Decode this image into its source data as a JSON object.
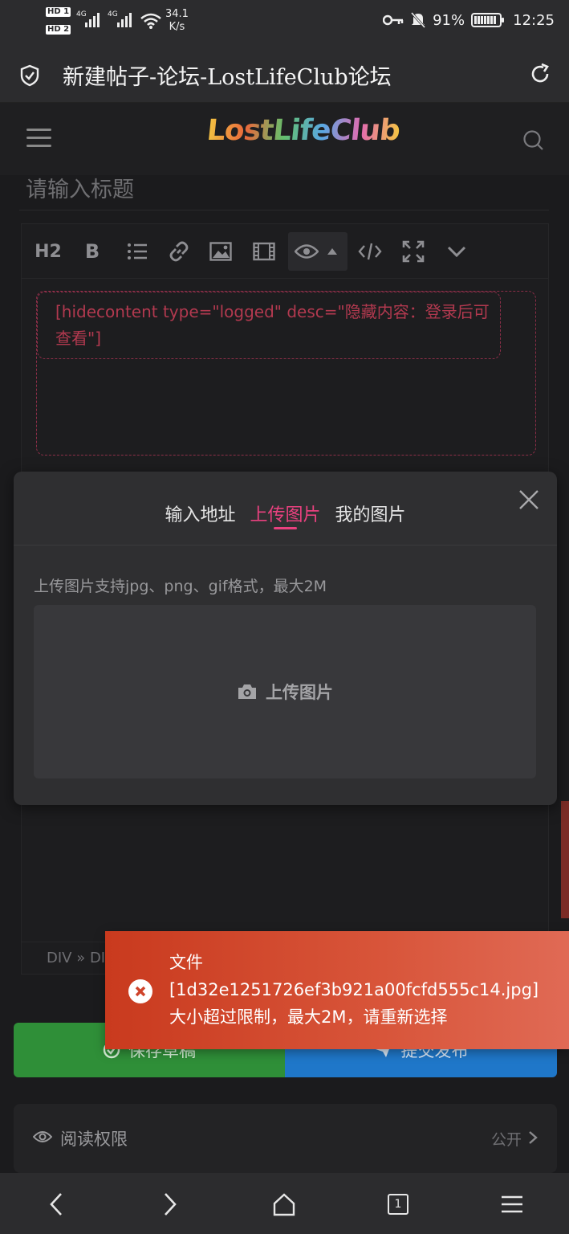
{
  "status_bar": {
    "hd1": "HD 1",
    "hd2": "HD 2",
    "signal1": "4G",
    "signal2": "4G",
    "speed_value": "34.1",
    "speed_unit": "K/s",
    "battery": "91%",
    "time": "12:25"
  },
  "browser": {
    "page_title": "新建帖子-论坛-LostLifeClub论坛",
    "tab_count": "1"
  },
  "site": {
    "logo_text": "LostLifeClub"
  },
  "editor": {
    "title_placeholder": "请输入标题",
    "toolbar": {
      "h2": "H2",
      "bold": "B"
    },
    "shortcode_text": "[hidecontent type=\"logged\" desc=\"隐藏内容：登录后可查看\"]",
    "breadcrumb": "DIV » DIV"
  },
  "modal": {
    "tabs": [
      "输入地址",
      "上传图片",
      "我的图片"
    ],
    "active_tab": 1,
    "hint": "上传图片支持jpg、png、gif格式，最大2M",
    "upload_label": "上传图片"
  },
  "toast": {
    "line1": "文件",
    "line2": "[1d32e1251726ef3b921a00fcfd555c14.jpg]",
    "line3": "大小超过限制，最大2M，请重新选择"
  },
  "actions": {
    "save_draft": "保存草稿",
    "publish": "提交发布"
  },
  "permission": {
    "label": "阅读权限",
    "value": "公开"
  },
  "colors": {
    "accent_pink": "#e9417f",
    "draft_green": "#2f8f38",
    "publish_blue": "#1f77c9",
    "toast_red": "#c93a1e"
  },
  "icons": [
    "shield-check-icon",
    "reload-icon",
    "menu-icon",
    "search-icon",
    "camera-icon",
    "close-icon",
    "error-icon",
    "eye-icon",
    "chevron-right-icon",
    "back-icon",
    "forward-icon",
    "home-icon",
    "tabs-icon",
    "menu-lines-icon"
  ]
}
